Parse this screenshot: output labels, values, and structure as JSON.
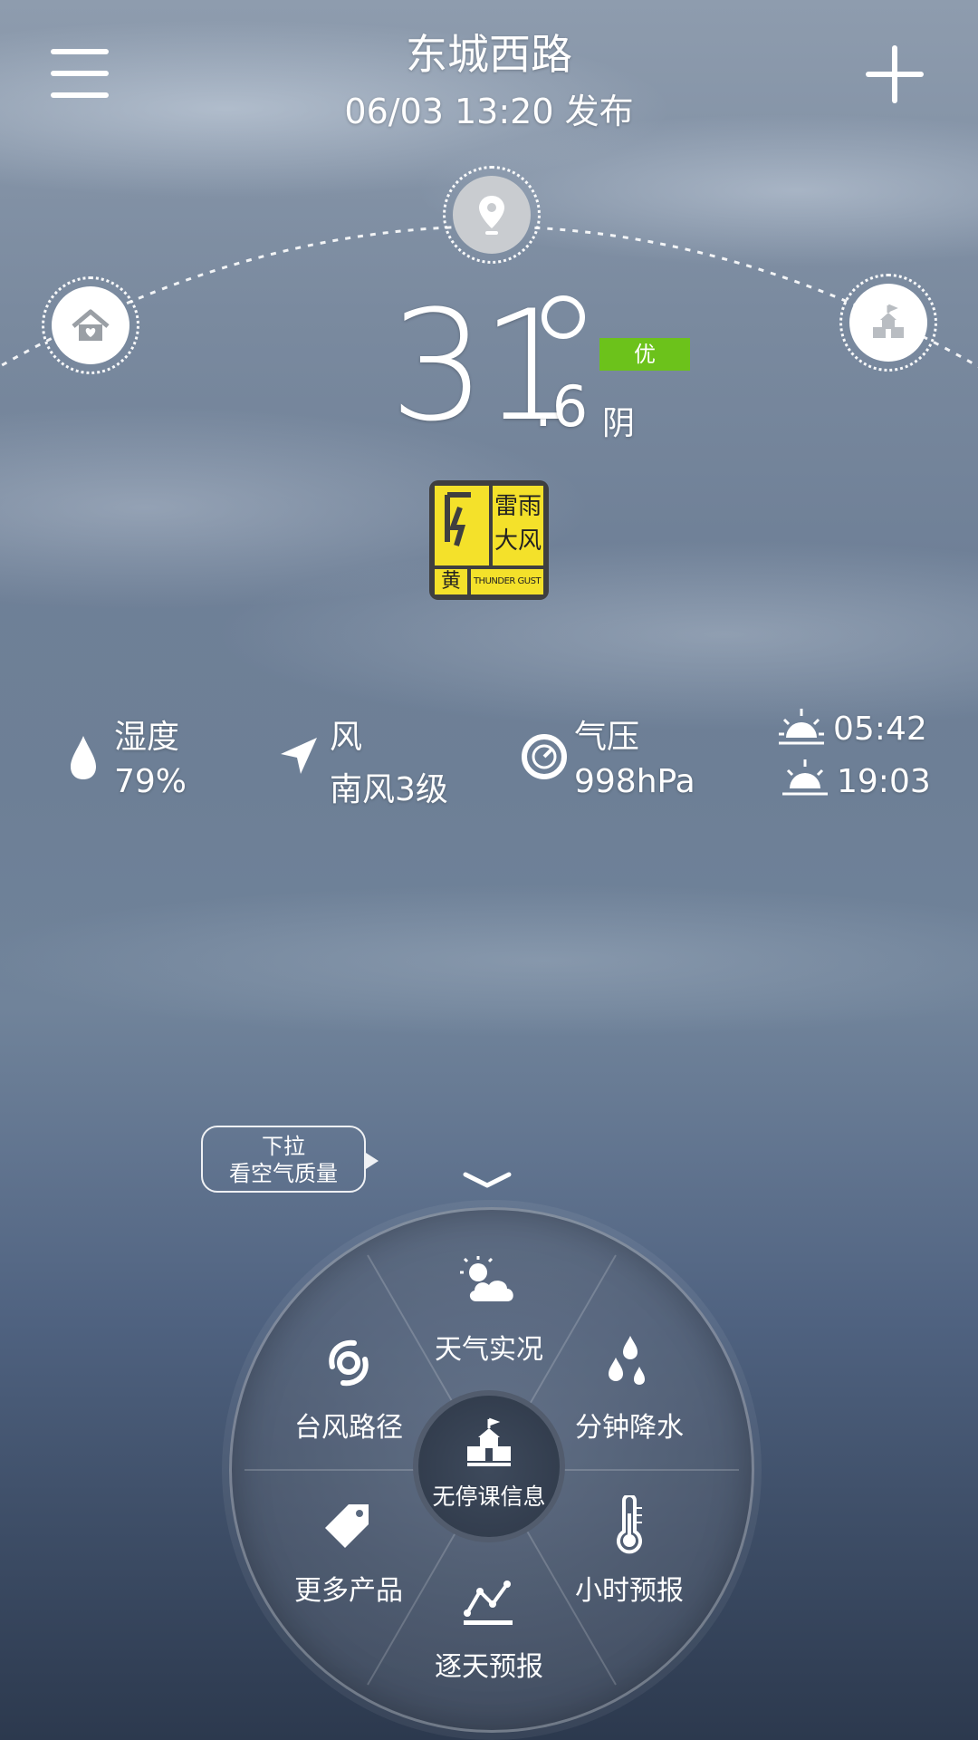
{
  "header": {
    "city": "东城西路",
    "publish_time": "06/03  13:20 发布"
  },
  "current": {
    "temp_int": "31",
    "temp_dec": ".6",
    "condition": "阴",
    "aqi_label": "优"
  },
  "warning": {
    "title_line1": "雷雨",
    "title_line2": "大风",
    "level": "黄",
    "english": "THUNDER GUST"
  },
  "stats": {
    "humidity": {
      "label": "湿度",
      "value": "79%"
    },
    "wind": {
      "label": "风",
      "value": "南风3级"
    },
    "pressure": {
      "label": "气压",
      "value": "998hPa"
    },
    "sunrise": "05:42",
    "sunset": "19:03"
  },
  "hint": {
    "line1": "下拉",
    "line2": "看空气质量"
  },
  "radial_menu": {
    "center": "无停课信息",
    "items": [
      {
        "label": "天气实况",
        "icon": "partly-cloudy-icon"
      },
      {
        "label": "分钟降水",
        "icon": "raindrops-icon"
      },
      {
        "label": "小时预报",
        "icon": "thermometer-icon"
      },
      {
        "label": "逐天预报",
        "icon": "trend-chart-icon"
      },
      {
        "label": "更多产品",
        "icon": "tag-icon"
      },
      {
        "label": "台风路径",
        "icon": "typhoon-icon"
      }
    ]
  },
  "colors": {
    "aqi_good": "#6cc21b",
    "warning_yellow": "#f4e12a"
  }
}
